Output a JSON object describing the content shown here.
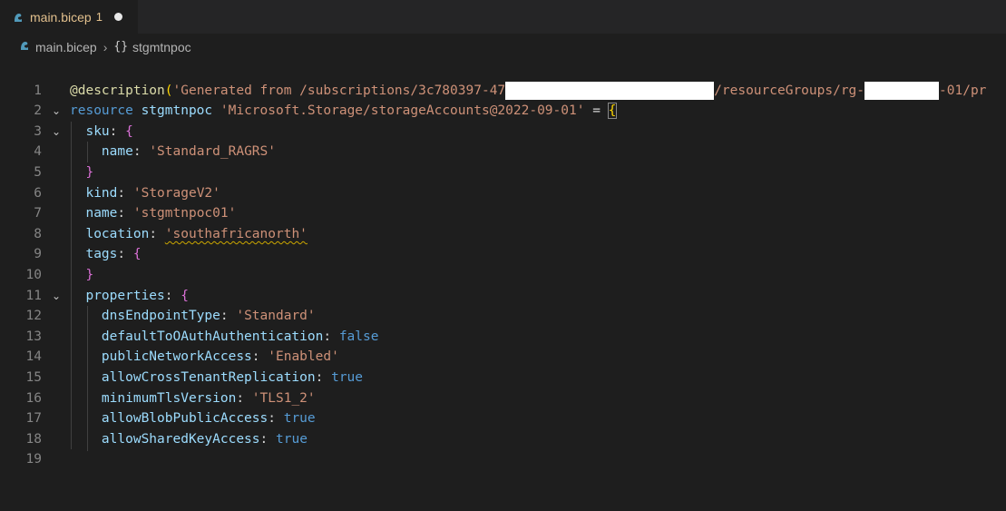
{
  "tab": {
    "icon": "bicep-file-icon",
    "label": "main.bicep",
    "badge": "1"
  },
  "breadcrumb": {
    "file": "main.bicep",
    "symbol_icon": "{}",
    "symbol": "stgmtnpoc"
  },
  "lines": [
    {
      "n": "1"
    },
    {
      "n": "2",
      "a": "@",
      "b": "description",
      "c": "(",
      "d": "'Generated from /subscriptions/3c780397-47",
      "e": "/resourceGroups/rg-",
      "f": "-01/pr"
    },
    {
      "n": "3",
      "a": "resource",
      "b": "stgmtnpoc",
      "c": "'Microsoft.Storage/storageAccounts@2022-09-01'",
      "d": "=",
      "e": "{"
    },
    {
      "n": "4",
      "a": "sku",
      "b": ":",
      "c": "{"
    },
    {
      "n": "5",
      "a": "name",
      "b": ":",
      "c": "'Standard_RAGRS'"
    },
    {
      "n": "6",
      "a": "}"
    },
    {
      "n": "7",
      "a": "kind",
      "b": ":",
      "c": "'StorageV2'"
    },
    {
      "n": "8",
      "a": "name",
      "b": ":",
      "c": "'stgmtnpoc01'"
    },
    {
      "n": "9",
      "a": "location",
      "b": ":",
      "c": "'southafricanorth'"
    },
    {
      "n": "10",
      "a": "tags",
      "b": ":",
      "c": "{"
    },
    {
      "n": "11",
      "a": "}"
    },
    {
      "n": "12",
      "a": "properties",
      "b": ":",
      "c": "{"
    },
    {
      "n": "13",
      "a": "dnsEndpointType",
      "b": ":",
      "c": "'Standard'"
    },
    {
      "n": "14",
      "a": "defaultToOAuthAuthentication",
      "b": ":",
      "c": "false"
    },
    {
      "n": "15",
      "a": "publicNetworkAccess",
      "b": ":",
      "c": "'Enabled'"
    },
    {
      "n": "16",
      "a": "allowCrossTenantReplication",
      "b": ":",
      "c": "true"
    },
    {
      "n": "17",
      "a": "minimumTlsVersion",
      "b": ":",
      "c": "'TLS1_2'"
    },
    {
      "n": "18",
      "a": "allowBlobPublicAccess",
      "b": ":",
      "c": "true"
    },
    {
      "n": "19",
      "a": "allowSharedKeyAccess",
      "b": ":",
      "c": "true"
    }
  ],
  "colors": {
    "background": "#1e1e1e",
    "keyword": "#569cd6",
    "property": "#9cdcfe",
    "string": "#ce9178",
    "decorator": "#dcdcaa",
    "tab_modified": "#e2c08d"
  }
}
